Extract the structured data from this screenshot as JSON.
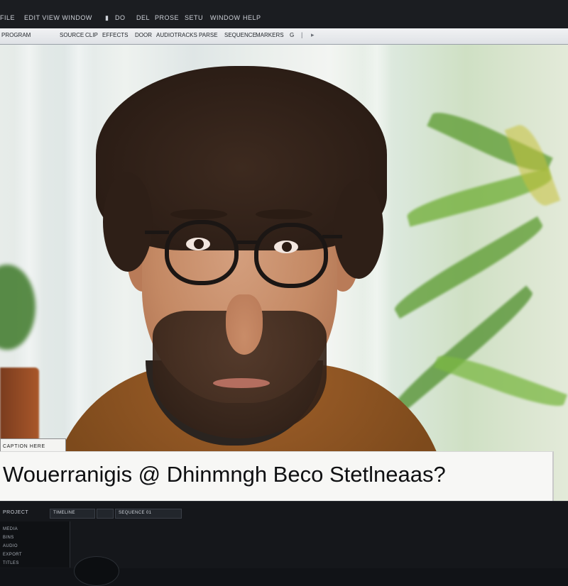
{
  "menu": {
    "items": [
      "FILE",
      "EDIT VIEW WINDOW",
      "▮",
      "DO",
      "DEL",
      "PROSE",
      "SETU",
      "WINDOW",
      "HELP"
    ]
  },
  "toolbar": {
    "items": [
      "PROGRAM",
      "SOURCE",
      "CLIP",
      "EFFECTS",
      "DOOR",
      "AUDIOTRACKS",
      "PARSE",
      "SEQUENCE",
      "MARKERS",
      "G"
    ]
  },
  "video": {
    "lower_third_tag": "CAPTION HERE",
    "caption": "Wouerranigis @ Dhinmngh Beco Stetlneaas?"
  },
  "bottom_panel": {
    "panel_title": "PROJECT",
    "tabs": [
      "TIMELINE",
      "SEQUENCE 01"
    ],
    "list_items": [
      "MEDIA",
      "BINS",
      "AUDIO",
      "EXPORT",
      "TITLES"
    ]
  },
  "colors": {
    "app_background": "#111317",
    "menubar": "#1b1d21",
    "toolbar": "#e4e7ea",
    "caption_background": "#f7f7f5",
    "caption_text": "#0f1012"
  }
}
